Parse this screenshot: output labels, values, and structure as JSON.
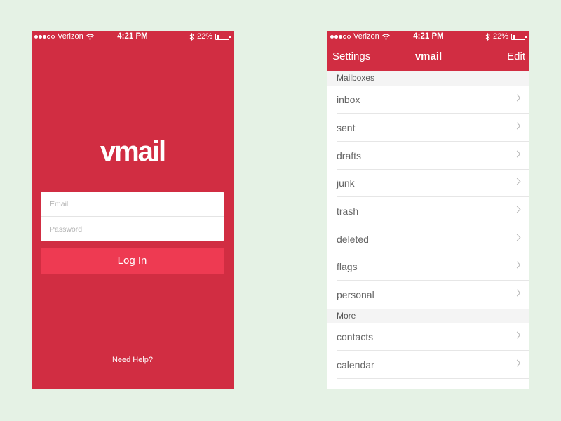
{
  "login_screen": {
    "status_bar": {
      "carrier": "Verizon",
      "time": "4:21 PM",
      "battery": "22%",
      "battery_level": 0.22,
      "signal_bars": 3
    },
    "logo_text": "vmail",
    "email_placeholder": "Email",
    "password_placeholder": "Password",
    "login_label": "Log In",
    "help_label": "Need Help?"
  },
  "mail_screen": {
    "status_bar": {
      "carrier": "Verizon",
      "time": "4:21 PM",
      "battery": "22%",
      "battery_level": 0.22,
      "signal_bars": 3
    },
    "nav": {
      "left_label": "Settings",
      "title": "vmail",
      "right_label": "Edit"
    },
    "sections": [
      {
        "header": "Mailboxes",
        "items": [
          "inbox",
          "sent",
          "drafts",
          "junk",
          "trash",
          "deleted",
          "flags",
          "personal"
        ]
      },
      {
        "header": "More",
        "items": [
          "contacts",
          "calendar"
        ]
      }
    ]
  },
  "colors": {
    "background": "#e5f2e5",
    "brand_red": "#d12d42",
    "button_red": "#ee3a52"
  },
  "icons": [
    "wifi-icon",
    "bluetooth-icon",
    "battery-icon",
    "chevron-right-icon"
  ]
}
